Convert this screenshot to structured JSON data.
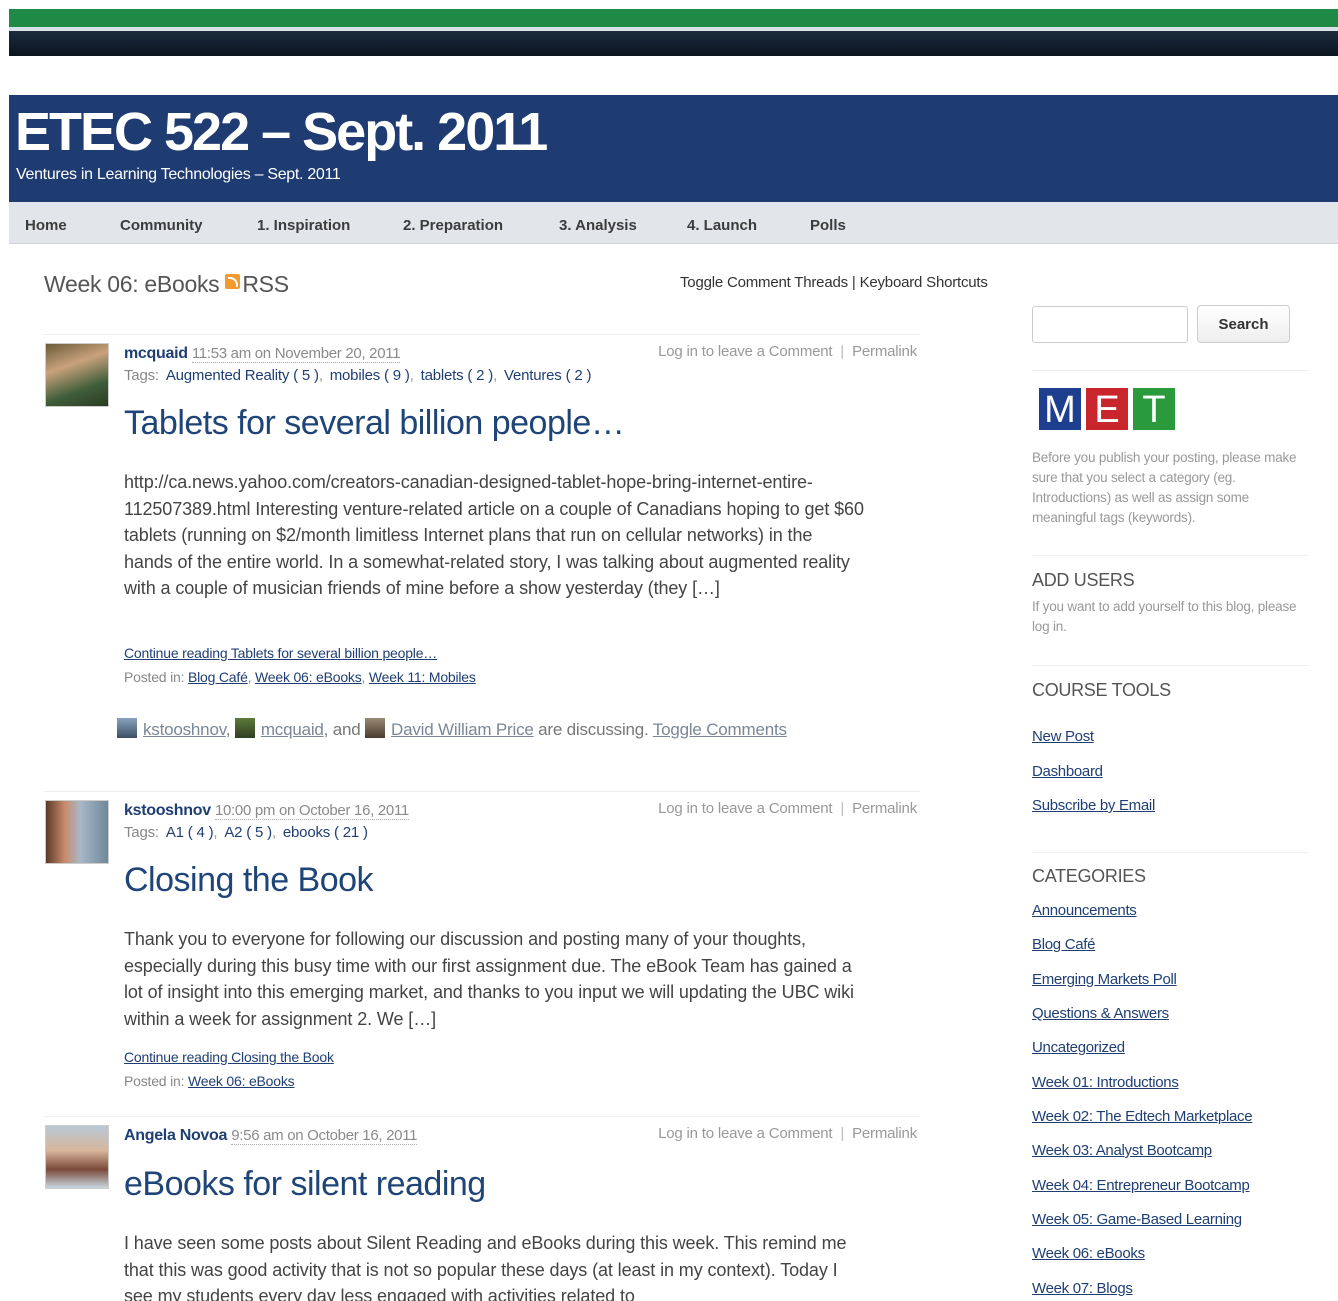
{
  "site": {
    "title": "ETEC 522 – Sept. 2011",
    "tagline": "Ventures in Learning Technologies – Sept. 2011"
  },
  "nav": [
    "Home",
    "Community",
    "1. Inspiration",
    "2. Preparation",
    "3. Analysis",
    "4. Launch",
    "Polls"
  ],
  "section": {
    "title": "Week 06: eBooks",
    "rss": "RSS"
  },
  "toolbar": {
    "toggle_threads": "Toggle Comment Threads",
    "separator": "|",
    "shortcuts": "Keyboard Shortcuts"
  },
  "post_actions": {
    "login": "Log in to leave a Comment",
    "permalink": "Permalink"
  },
  "posts": [
    {
      "author": "mcquaid",
      "date": "11:53 am on November 20, 2011",
      "tags_label": "Tags:",
      "tags": [
        "Augmented Reality ( 5 )",
        "mobiles ( 9 )",
        "tablets ( 2 )",
        "Ventures ( 2 )"
      ],
      "title": "Tablets for several billion people…",
      "excerpt": "http://ca.news.yahoo.com/creators-canadian-designed-tablet-hope-bring-internet-entire-112507389.html Interesting venture-related article on a couple of Canadians hoping to get $60 tablets (running on $2/month limitless Internet plans that run on cellular networks) in the hands of the entire world. In a somewhat-related story, I was talking about augmented reality with a couple of musician friends of mine before a show yesterday (they […]",
      "continue": "Continue reading Tablets for several billion people…",
      "posted_in_label": "Posted in:",
      "posted_in": [
        "Blog Café",
        "Week 06: eBooks",
        "Week 11: Mobiles"
      ],
      "discussion": {
        "participants": [
          "kstooshnov",
          "mcquaid",
          "David William Price"
        ],
        "comma": ",",
        "and": "and",
        "suffix": "are discussing.",
        "toggle": "Toggle Comments"
      }
    },
    {
      "author": "kstooshnov",
      "date": "10:00 pm on October 16, 2011",
      "tags_label": "Tags:",
      "tags": [
        "A1 ( 4 )",
        "A2 ( 5 )",
        "ebooks ( 21 )"
      ],
      "title": "Closing the Book",
      "excerpt": "Thank you to everyone for following our discussion and posting many of your thoughts, especially during this busy time with our first assignment due.  The eBook Team has gained a lot of insight into this emerging market, and thanks to you input we will updating the UBC wiki within a week for assignment 2. We […]",
      "continue": "Continue reading Closing the Book",
      "posted_in_label": "Posted in:",
      "posted_in": [
        "Week 06: eBooks"
      ]
    },
    {
      "author": "Angela Novoa",
      "date": "9:56 am on October 16, 2011",
      "title": "eBooks for silent reading",
      "excerpt": "I have seen some posts about Silent Reading and eBooks during this week. This remind me that this was good activity that is not so popular these days (at least in my context). Today I see my students every day less engaged with activities related to"
    }
  ],
  "sidebar": {
    "search_button": "Search",
    "met_letters": [
      "M",
      "E",
      "T"
    ],
    "met_colors": [
      "#1e3f8f",
      "#c8262c",
      "#2a9a3c"
    ],
    "met_note": "Before you publish your posting, please make sure that you select a category (eg. Introductions) as well as assign some meaningful tags (keywords).",
    "add_users_heading": "ADD USERS",
    "add_users_note": "If you want to add yourself to this blog, please log in.",
    "course_tools_heading": "COURSE TOOLS",
    "course_tools": [
      "New Post",
      "Dashboard",
      "Subscribe by Email"
    ],
    "categories_heading": "CATEGORIES",
    "categories": [
      "Announcements",
      "Blog Café",
      "Emerging Markets Poll",
      "Questions & Answers",
      "Uncategorized",
      "Week 01: Introductions",
      "Week 02: The Edtech Marketplace",
      "Week 03: Analyst Bootcamp",
      "Week 04: Entrepreneur Bootcamp",
      "Week 05: Game-Based Learning",
      "Week 06: eBooks",
      "Week 07: Blogs"
    ]
  }
}
